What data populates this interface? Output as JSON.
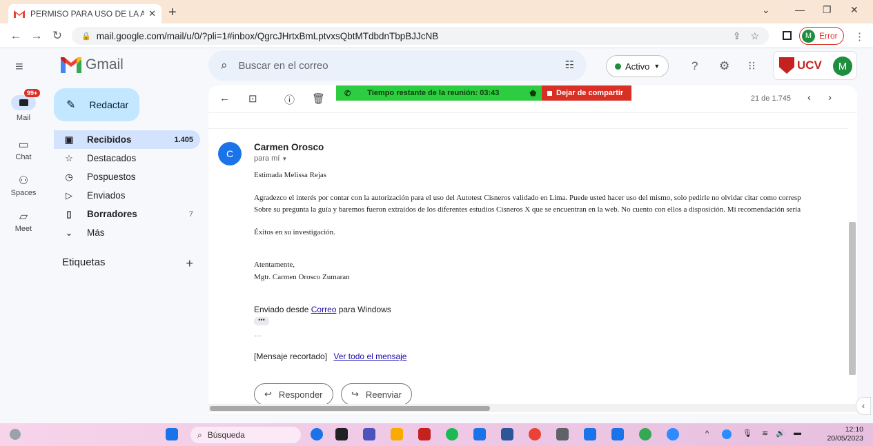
{
  "browser": {
    "tab_title": "PERMISO PARA USO DE LA ADAP",
    "url": "mail.google.com/mail/u/0/?pli=1#inbox/QgrcJHrtxBmLptvxsQbtMTdbdnTbpBJJcNB",
    "profile_initial": "M",
    "profile_status": "Error"
  },
  "gmail": {
    "app_name": "Gmail",
    "search_placeholder": "Buscar en el correo",
    "status": "Activo",
    "org_logo_text": "UCV",
    "account_initial": "M"
  },
  "rail": {
    "mail_badge": "99+",
    "items": [
      {
        "label": "Mail"
      },
      {
        "label": "Chat"
      },
      {
        "label": "Spaces"
      },
      {
        "label": "Meet"
      }
    ]
  },
  "nav": {
    "compose": "Redactar",
    "items": [
      {
        "label": "Recibidos",
        "count": "1.405"
      },
      {
        "label": "Destacados",
        "count": ""
      },
      {
        "label": "Pospuestos",
        "count": ""
      },
      {
        "label": "Enviados",
        "count": ""
      },
      {
        "label": "Borradores",
        "count": "7"
      },
      {
        "label": "Más",
        "count": ""
      }
    ],
    "labels_heading": "Etiquetas"
  },
  "meeting": {
    "timer": "Tiempo restante de la reunión: 03:43",
    "stop_sharing": "Dejar de compartir"
  },
  "message": {
    "pager": "21 de 1.745",
    "sender_initial": "C",
    "sender": "Carmen Orosco",
    "to": "para mí",
    "greeting": "Estimada Melissa Rejas",
    "para1": "Agradezco el interés por contar con la autorización para el uso del Autotest Cisneros validado en Lima. Puede usted hacer uso del mismo, solo pedirle no olvidar citar como corresp",
    "para2": "Sobre su pregunta la guía y baremos fueron extraídos de los diferentes estudios Cisneros X que se encuentran en la web. No cuento con ellos a disposición. Mi recomendación sería",
    "closing": "Éxitos en su investigación.",
    "sign1": "Atentamente,",
    "sign2": "Mgtr. Carmen Orosco Zumaran",
    "sent_from_prefix": "Enviado desde ",
    "sent_from_link": "Correo",
    "sent_from_suffix": " para Windows",
    "trimmed": "[Mensaje recortado]",
    "view_all": "Ver todo el mensaje",
    "reply": "Responder",
    "forward": "Reenviar"
  },
  "taskbar": {
    "search": "Búsqueda",
    "time": "12:10",
    "date": "20/05/2023"
  }
}
